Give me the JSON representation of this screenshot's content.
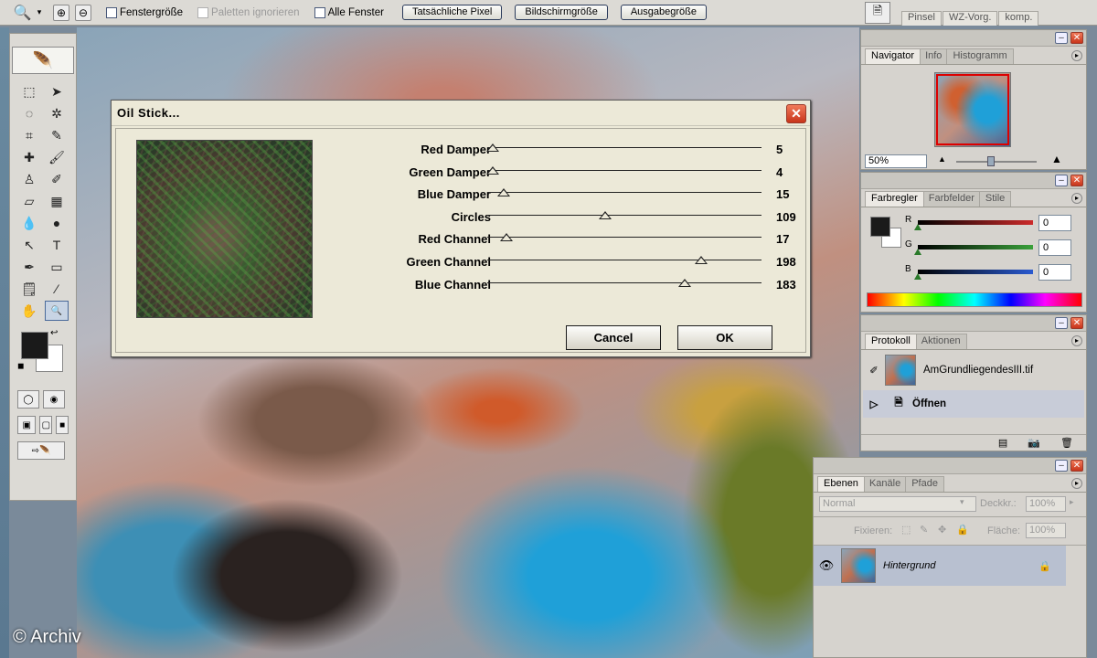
{
  "options_bar": {
    "zoom_icon": "magnifier-icon",
    "checkboxes": [
      {
        "label": "Fenstergröße",
        "checked": false,
        "enabled": true
      },
      {
        "label": "Paletten ignorieren",
        "checked": false,
        "enabled": false
      },
      {
        "label": "Alle Fenster",
        "checked": false,
        "enabled": true
      }
    ],
    "buttons": [
      "Tatsächliche Pixel",
      "Bildschirmgröße",
      "Ausgabegröße"
    ],
    "palette_well_tabs": [
      "Pinsel",
      "WZ-Vorg.",
      "komp."
    ]
  },
  "dialog": {
    "title": "Oil Stick...",
    "sliders": [
      {
        "label": "Red Damper",
        "value": "5",
        "pos": 0.02
      },
      {
        "label": "Green Damper",
        "value": "4",
        "pos": 0.02
      },
      {
        "label": "Blue Damper",
        "value": "15",
        "pos": 0.06
      },
      {
        "label": "Circles",
        "value": "109",
        "pos": 0.43
      },
      {
        "label": "Red Channel",
        "value": "17",
        "pos": 0.07
      },
      {
        "label": "Green Channel",
        "value": "198",
        "pos": 0.78
      },
      {
        "label": "Blue Channel",
        "value": "183",
        "pos": 0.72
      }
    ],
    "cancel": "Cancel",
    "ok": "OK"
  },
  "navigator": {
    "tabs": [
      "Navigator",
      "Info",
      "Histogramm"
    ],
    "zoom": "50%"
  },
  "color": {
    "tabs": [
      "Farbregler",
      "Farbfelder",
      "Stile"
    ],
    "channels": [
      {
        "label": "R",
        "value": "0",
        "color": "#cc2a2a"
      },
      {
        "label": "G",
        "value": "0",
        "color": "#3aa03a"
      },
      {
        "label": "B",
        "value": "0",
        "color": "#2a5ad0"
      }
    ]
  },
  "history": {
    "tabs": [
      "Protokoll",
      "Aktionen"
    ],
    "snapshot": "AmGrundliegendesIII.tif",
    "step": "Öffnen"
  },
  "layers": {
    "tabs": [
      "Ebenen",
      "Kanäle",
      "Pfade"
    ],
    "blend_mode": "Normal",
    "opacity_label": "Deckkr.:",
    "opacity": "100%",
    "lock_label": "Fixieren:",
    "fill_label": "Fläche:",
    "fill": "100%",
    "layer_name": "Hintergrund"
  },
  "copyright": "© Archiv"
}
